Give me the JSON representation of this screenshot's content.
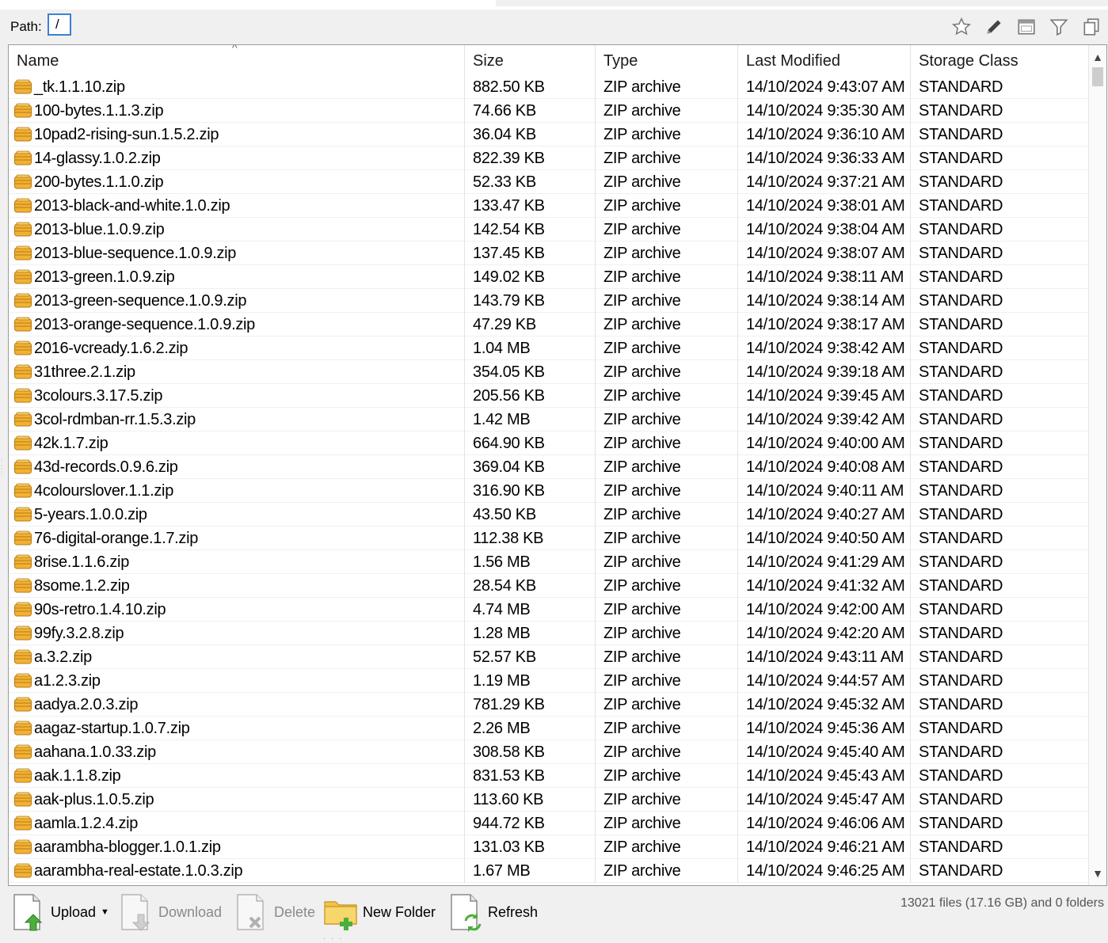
{
  "path": {
    "label": "Path:",
    "value": "/"
  },
  "toolbar_icons": [
    "star-icon",
    "pencil-icon",
    "window-icon",
    "filter-icon",
    "copy-icon"
  ],
  "columns": {
    "name": "Name",
    "size": "Size",
    "type": "Type",
    "modified": "Last Modified",
    "storage": "Storage Class",
    "sort_indicator": "^"
  },
  "files": [
    {
      "name": "_tk.1.1.10.zip",
      "size": "882.50 KB",
      "type": "ZIP archive",
      "modified": "14/10/2024 9:43:07 AM",
      "storage": "STANDARD"
    },
    {
      "name": "100-bytes.1.1.3.zip",
      "size": "74.66 KB",
      "type": "ZIP archive",
      "modified": "14/10/2024 9:35:30 AM",
      "storage": "STANDARD"
    },
    {
      "name": "10pad2-rising-sun.1.5.2.zip",
      "size": "36.04 KB",
      "type": "ZIP archive",
      "modified": "14/10/2024 9:36:10 AM",
      "storage": "STANDARD"
    },
    {
      "name": "14-glassy.1.0.2.zip",
      "size": "822.39 KB",
      "type": "ZIP archive",
      "modified": "14/10/2024 9:36:33 AM",
      "storage": "STANDARD"
    },
    {
      "name": "200-bytes.1.1.0.zip",
      "size": "52.33 KB",
      "type": "ZIP archive",
      "modified": "14/10/2024 9:37:21 AM",
      "storage": "STANDARD"
    },
    {
      "name": "2013-black-and-white.1.0.zip",
      "size": "133.47 KB",
      "type": "ZIP archive",
      "modified": "14/10/2024 9:38:01 AM",
      "storage": "STANDARD"
    },
    {
      "name": "2013-blue.1.0.9.zip",
      "size": "142.54 KB",
      "type": "ZIP archive",
      "modified": "14/10/2024 9:38:04 AM",
      "storage": "STANDARD"
    },
    {
      "name": "2013-blue-sequence.1.0.9.zip",
      "size": "137.45 KB",
      "type": "ZIP archive",
      "modified": "14/10/2024 9:38:07 AM",
      "storage": "STANDARD"
    },
    {
      "name": "2013-green.1.0.9.zip",
      "size": "149.02 KB",
      "type": "ZIP archive",
      "modified": "14/10/2024 9:38:11 AM",
      "storage": "STANDARD"
    },
    {
      "name": "2013-green-sequence.1.0.9.zip",
      "size": "143.79 KB",
      "type": "ZIP archive",
      "modified": "14/10/2024 9:38:14 AM",
      "storage": "STANDARD"
    },
    {
      "name": "2013-orange-sequence.1.0.9.zip",
      "size": "47.29 KB",
      "type": "ZIP archive",
      "modified": "14/10/2024 9:38:17 AM",
      "storage": "STANDARD"
    },
    {
      "name": "2016-vcready.1.6.2.zip",
      "size": "1.04 MB",
      "type": "ZIP archive",
      "modified": "14/10/2024 9:38:42 AM",
      "storage": "STANDARD"
    },
    {
      "name": "31three.2.1.zip",
      "size": "354.05 KB",
      "type": "ZIP archive",
      "modified": "14/10/2024 9:39:18 AM",
      "storage": "STANDARD"
    },
    {
      "name": "3colours.3.17.5.zip",
      "size": "205.56 KB",
      "type": "ZIP archive",
      "modified": "14/10/2024 9:39:45 AM",
      "storage": "STANDARD"
    },
    {
      "name": "3col-rdmban-rr.1.5.3.zip",
      "size": "1.42 MB",
      "type": "ZIP archive",
      "modified": "14/10/2024 9:39:42 AM",
      "storage": "STANDARD"
    },
    {
      "name": "42k.1.7.zip",
      "size": "664.90 KB",
      "type": "ZIP archive",
      "modified": "14/10/2024 9:40:00 AM",
      "storage": "STANDARD"
    },
    {
      "name": "43d-records.0.9.6.zip",
      "size": "369.04 KB",
      "type": "ZIP archive",
      "modified": "14/10/2024 9:40:08 AM",
      "storage": "STANDARD"
    },
    {
      "name": "4colourslover.1.1.zip",
      "size": "316.90 KB",
      "type": "ZIP archive",
      "modified": "14/10/2024 9:40:11 AM",
      "storage": "STANDARD"
    },
    {
      "name": "5-years.1.0.0.zip",
      "size": "43.50 KB",
      "type": "ZIP archive",
      "modified": "14/10/2024 9:40:27 AM",
      "storage": "STANDARD"
    },
    {
      "name": "76-digital-orange.1.7.zip",
      "size": "112.38 KB",
      "type": "ZIP archive",
      "modified": "14/10/2024 9:40:50 AM",
      "storage": "STANDARD"
    },
    {
      "name": "8rise.1.1.6.zip",
      "size": "1.56 MB",
      "type": "ZIP archive",
      "modified": "14/10/2024 9:41:29 AM",
      "storage": "STANDARD"
    },
    {
      "name": "8some.1.2.zip",
      "size": "28.54 KB",
      "type": "ZIP archive",
      "modified": "14/10/2024 9:41:32 AM",
      "storage": "STANDARD"
    },
    {
      "name": "90s-retro.1.4.10.zip",
      "size": "4.74 MB",
      "type": "ZIP archive",
      "modified": "14/10/2024 9:42:00 AM",
      "storage": "STANDARD"
    },
    {
      "name": "99fy.3.2.8.zip",
      "size": "1.28 MB",
      "type": "ZIP archive",
      "modified": "14/10/2024 9:42:20 AM",
      "storage": "STANDARD"
    },
    {
      "name": "a.3.2.zip",
      "size": "52.57 KB",
      "type": "ZIP archive",
      "modified": "14/10/2024 9:43:11 AM",
      "storage": "STANDARD"
    },
    {
      "name": "a1.2.3.zip",
      "size": "1.19 MB",
      "type": "ZIP archive",
      "modified": "14/10/2024 9:44:57 AM",
      "storage": "STANDARD"
    },
    {
      "name": "aadya.2.0.3.zip",
      "size": "781.29 KB",
      "type": "ZIP archive",
      "modified": "14/10/2024 9:45:32 AM",
      "storage": "STANDARD"
    },
    {
      "name": "aagaz-startup.1.0.7.zip",
      "size": "2.26 MB",
      "type": "ZIP archive",
      "modified": "14/10/2024 9:45:36 AM",
      "storage": "STANDARD"
    },
    {
      "name": "aahana.1.0.33.zip",
      "size": "308.58 KB",
      "type": "ZIP archive",
      "modified": "14/10/2024 9:45:40 AM",
      "storage": "STANDARD"
    },
    {
      "name": "aak.1.1.8.zip",
      "size": "831.53 KB",
      "type": "ZIP archive",
      "modified": "14/10/2024 9:45:43 AM",
      "storage": "STANDARD"
    },
    {
      "name": "aak-plus.1.0.5.zip",
      "size": "113.60 KB",
      "type": "ZIP archive",
      "modified": "14/10/2024 9:45:47 AM",
      "storage": "STANDARD"
    },
    {
      "name": "aamla.1.2.4.zip",
      "size": "944.72 KB",
      "type": "ZIP archive",
      "modified": "14/10/2024 9:46:06 AM",
      "storage": "STANDARD"
    },
    {
      "name": "aarambha-blogger.1.0.1.zip",
      "size": "131.03 KB",
      "type": "ZIP archive",
      "modified": "14/10/2024 9:46:21 AM",
      "storage": "STANDARD"
    },
    {
      "name": "aarambha-real-estate.1.0.3.zip",
      "size": "1.67 MB",
      "type": "ZIP archive",
      "modified": "14/10/2024 9:46:25 AM",
      "storage": "STANDARD"
    }
  ],
  "bottom": {
    "upload": "Upload",
    "download": "Download",
    "delete": "Delete",
    "new_folder": "New Folder",
    "refresh": "Refresh",
    "status": "13021 files (17.16 GB) and 0 folders"
  },
  "colors": {
    "accent": "#3d7fd6",
    "zip_icon": "#f2b134",
    "background": "#f0f0f0"
  }
}
